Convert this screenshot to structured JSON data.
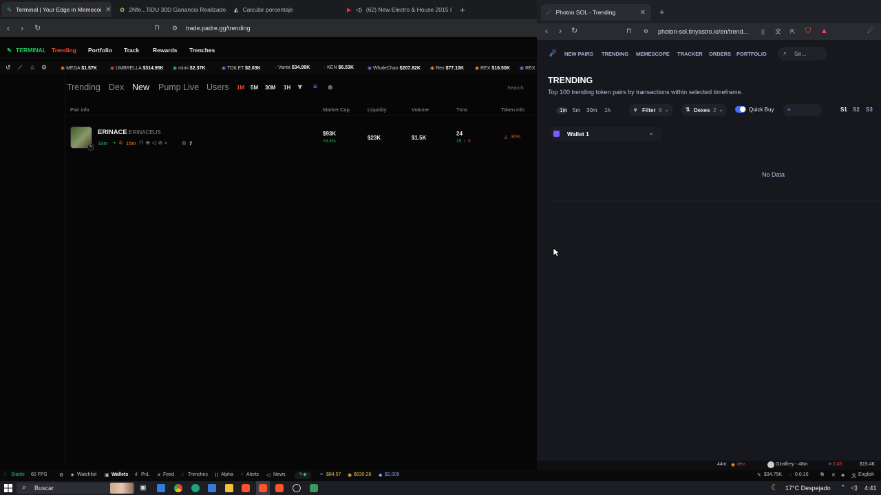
{
  "left_browser": {
    "tabs": [
      {
        "title": "Terminal | Your Edge in Memecoi",
        "active": true
      },
      {
        "title": "2Nfe...TiDU 30D Ganancia Realizado",
        "active": false
      },
      {
        "title": "Calcular porcentaje",
        "active": false
      },
      {
        "title": "(62) New Electro & House 2015 I",
        "active": false
      }
    ],
    "url": "trade.padre.gg/trending"
  },
  "padre": {
    "brand": "TERMINAL",
    "nav": [
      "Trending",
      "Portfolio",
      "Track",
      "Rewards",
      "Trenches"
    ],
    "ticker": [
      {
        "name": "MEGA",
        "value": "$1.57K"
      },
      {
        "name": "UMBRELLA",
        "value": "$314.95K"
      },
      {
        "name": "mimi",
        "value": "$2.37K"
      },
      {
        "name": "TOILET",
        "value": "$2.03K"
      },
      {
        "name": "Vanta",
        "value": "$34.99K"
      },
      {
        "name": "KEN",
        "value": "$6.53K"
      },
      {
        "name": "WhaleChan",
        "value": "$207.82K"
      },
      {
        "name": "Rex",
        "value": "$77.10K"
      },
      {
        "name": "REX",
        "value": "$16.50K"
      },
      {
        "name": "REX",
        "value": ""
      }
    ],
    "subnav": [
      "Trending",
      "Dex",
      "New",
      "Pump Live",
      "Users"
    ],
    "subnav_active": "New",
    "timeframes": [
      "1M",
      "5M",
      "30M",
      "1H"
    ],
    "search_placeholder": "Search",
    "columns": [
      "Pair info",
      "Market Cap",
      "Liquidity",
      "Volume",
      "Txns",
      "Token info"
    ],
    "rows": [
      {
        "ticker": "ERINACE",
        "name": "ERINACEUS",
        "age": "33m",
        "age2": "15m",
        "holders": "7",
        "market_cap": "$93K",
        "market_cap_change": "+9.4%",
        "liquidity": "$23K",
        "volume": "$1.5K",
        "txns": "24",
        "buys": "15",
        "sells": "9",
        "token_info": "36%"
      }
    ],
    "status": {
      "stable": "Stable",
      "fps": "60 FPS",
      "items": [
        "Watchlist",
        "Wallets",
        "PnL",
        "Feed",
        "Trenches",
        "Alpha",
        "Alerts",
        "News"
      ],
      "sol_price": "$84.57",
      "btc_price": "$630.28",
      "eth_price": "$2,009"
    }
  },
  "right_browser": {
    "tab_title": "Photon SOL - Trending",
    "url": "photon-sol.tinyastro.io/en/trend..."
  },
  "photon": {
    "nav": [
      "NEW PAIRS",
      "TRENDING",
      "MEMESCOPE",
      "TRACKER",
      "ORDERS",
      "PORTFOLIO"
    ],
    "search_placeholder": "Se...",
    "title": "TRENDING",
    "subtitle": "Top 100 trending token pairs by transactions within selected timeframe.",
    "timeframes": [
      "1m",
      "5m",
      "30m",
      "1h"
    ],
    "filter_label": "Filter",
    "filter_count": "9",
    "dexes_label": "Dexes",
    "dexes_count": "2",
    "quick_buy_label": "Quick Buy",
    "presets": [
      "S1",
      "S2",
      "S3"
    ],
    "wallet": "Wallet 1",
    "empty_text": "No Data",
    "footer": {
      "time": "44m",
      "dev": "dev",
      "user": "Giraffrey - 48m",
      "sol": "0.45",
      "value": "$15.4K",
      "mcap": "$34.75K",
      "ratio": "0.0,10",
      "lang": "English"
    }
  },
  "taskbar": {
    "search": "Buscar",
    "weather": "17°C Despejado",
    "time": "4:41"
  }
}
